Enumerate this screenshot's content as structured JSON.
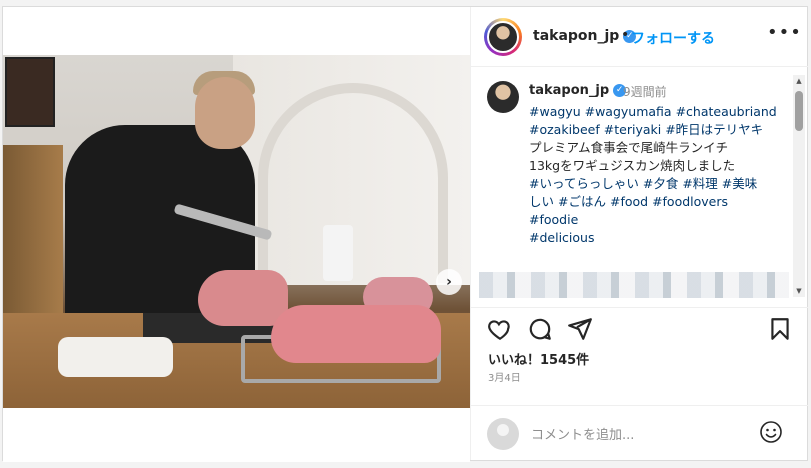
{
  "post": {
    "media_next_label": "›",
    "carousel_dots": 6,
    "carousel_active": 0
  },
  "header": {
    "username": "takapon_jp",
    "verified_glyph": "✓",
    "separator": "•",
    "follow_label": "フォローする",
    "more_label": "•••"
  },
  "caption": {
    "username": "takapon_jp",
    "time": "9週間前",
    "lines": [
      [
        {
          "t": "#wagyu",
          "tag": true
        },
        {
          "t": " "
        },
        {
          "t": "#wagyumafia",
          "tag": true
        },
        {
          "t": " "
        },
        {
          "t": "#chateaubriand",
          "tag": true
        }
      ],
      [
        {
          "t": "#ozakibeef",
          "tag": true
        },
        {
          "t": " "
        },
        {
          "t": "#teriyaki",
          "tag": true
        },
        {
          "t": " "
        },
        {
          "t": "#昨日はテリヤキ",
          "tag": true
        }
      ],
      [
        {
          "t": "プレミアム食事会で尾崎牛ランイチ"
        }
      ],
      [
        {
          "t": "13kgをワギュジスカン焼肉しました"
        }
      ],
      [
        {
          "t": "#いってらっしゃい",
          "tag": true
        },
        {
          "t": " "
        },
        {
          "t": "#夕食",
          "tag": true
        },
        {
          "t": " "
        },
        {
          "t": "#料理",
          "tag": true
        },
        {
          "t": " "
        },
        {
          "t": "#美味",
          "tag": true
        }
      ],
      [
        {
          "t": "しい",
          "tag": true
        },
        {
          "t": " "
        },
        {
          "t": "#ごはん",
          "tag": true
        },
        {
          "t": " "
        },
        {
          "t": "#food",
          "tag": true
        },
        {
          "t": " "
        },
        {
          "t": "#foodlovers",
          "tag": true
        }
      ],
      [
        {
          "t": "#foodie",
          "tag": true
        }
      ],
      [
        {
          "t": "#delicious",
          "tag": true
        }
      ]
    ]
  },
  "actions": {
    "like_icon": "heart-icon",
    "comment_icon": "comment-icon",
    "share_icon": "paper-plane-icon",
    "save_icon": "bookmark-icon"
  },
  "likes_text": "いいね！1545件",
  "date_text": "3月4日",
  "comment": {
    "placeholder": "コメントを追加..."
  },
  "colors": {
    "accent": "#0095f6",
    "hashtag": "#00376b",
    "muted": "#8e8e8e",
    "verified": "#3897f0"
  }
}
